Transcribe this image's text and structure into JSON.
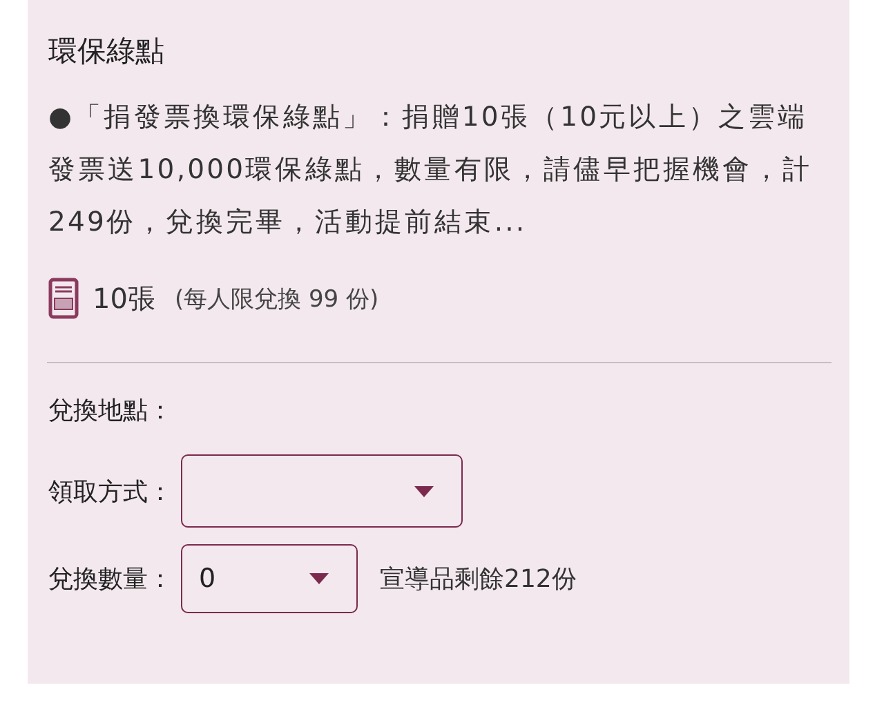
{
  "title": "環保綠點",
  "description": "●「捐發票換環保綠點」：捐贈10張（10元以上）之雲端發票送10,000環保綠點，數量有限，請儘早把握機會，計249份，兌換完畢，活動提前結束...",
  "cost": {
    "amount": "10張",
    "limit": "(每人限兌換 99 份)"
  },
  "location_label": "兌換地點：",
  "pickup": {
    "label": "領取方式："
  },
  "quantity": {
    "label": "兌換數量：",
    "value": "0",
    "remaining": "宣導品剩餘212份"
  }
}
